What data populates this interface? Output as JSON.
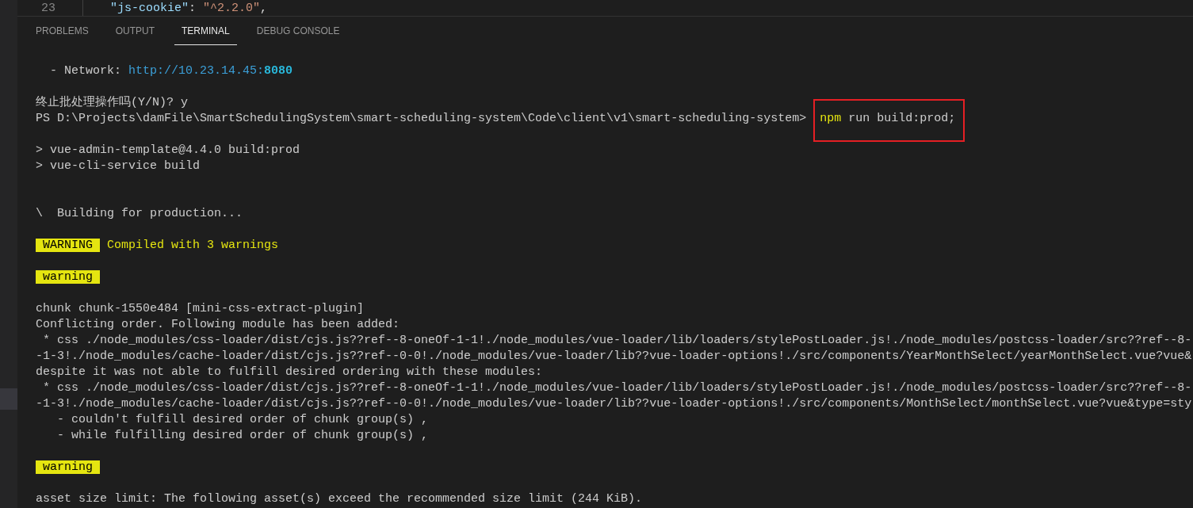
{
  "editor": {
    "line_number": "23",
    "key": "\"js-cookie\"",
    "separator": ": ",
    "value": "\"^2.2.0\"",
    "trailing": ","
  },
  "panel": {
    "tabs": [
      {
        "label": "PROBLEMS",
        "selected": false
      },
      {
        "label": "OUTPUT",
        "selected": false
      },
      {
        "label": "TERMINAL",
        "selected": true
      },
      {
        "label": "DEBUG CONSOLE",
        "selected": false
      }
    ]
  },
  "terminal": {
    "lines": [
      {
        "kind": "network",
        "label": "  - Network: ",
        "url": "http://10.23.14.45:",
        "port": "8080"
      },
      {
        "kind": "blank"
      },
      {
        "kind": "text",
        "text": "终止批处理操作吗(Y/N)? y"
      },
      {
        "kind": "prompt",
        "path": "PS D:\\Projects\\damFile\\SmartSchedulingSystem\\smart-scheduling-system\\Code\\client\\v1\\smart-scheduling-system> ",
        "command": "npm",
        "args": " run build:prod;",
        "highlighted": true
      },
      {
        "kind": "blank"
      },
      {
        "kind": "text",
        "text": "> vue-admin-template@4.4.0 build:prod"
      },
      {
        "kind": "text",
        "text": "> vue-cli-service build"
      },
      {
        "kind": "blank"
      },
      {
        "kind": "blank"
      },
      {
        "kind": "spinner",
        "glyph": "\\",
        "text": "  Building for production..."
      },
      {
        "kind": "blank"
      },
      {
        "kind": "badge",
        "badge": "WARNING",
        "text": "Compiled with 3 warnings"
      },
      {
        "kind": "blank"
      },
      {
        "kind": "badge",
        "badge": "warning"
      },
      {
        "kind": "blank"
      },
      {
        "kind": "text",
        "text": "chunk chunk-1550e484 [mini-css-extract-plugin]"
      },
      {
        "kind": "text",
        "text": "Conflicting order. Following module has been added:"
      },
      {
        "kind": "text",
        "text": " * css ./node_modules/css-loader/dist/cjs.js??ref--8-oneOf-1-1!./node_modules/vue-loader/lib/loaders/stylePostLoader.js!./node_modules/postcss-loader/src??ref--8-"
      },
      {
        "kind": "text",
        "text": "-1-3!./node_modules/cache-loader/dist/cjs.js??ref--0-0!./node_modules/vue-loader/lib??vue-loader-options!./src/components/YearMonthSelect/yearMonthSelect.vue?vue&"
      },
      {
        "kind": "text",
        "text": "despite it was not able to fulfill desired ordering with these modules:"
      },
      {
        "kind": "text",
        "text": " * css ./node_modules/css-loader/dist/cjs.js??ref--8-oneOf-1-1!./node_modules/vue-loader/lib/loaders/stylePostLoader.js!./node_modules/postcss-loader/src??ref--8-"
      },
      {
        "kind": "text",
        "text": "-1-3!./node_modules/cache-loader/dist/cjs.js??ref--0-0!./node_modules/vue-loader/lib??vue-loader-options!./src/components/MonthSelect/monthSelect.vue?vue&type=sty"
      },
      {
        "kind": "text",
        "text": "   - couldn't fulfill desired order of chunk group(s) ,"
      },
      {
        "kind": "text",
        "text": "   - while fulfilling desired order of chunk group(s) ,"
      },
      {
        "kind": "blank"
      },
      {
        "kind": "badge",
        "badge": "warning"
      },
      {
        "kind": "blank"
      },
      {
        "kind": "text",
        "text": "asset size limit: The following asset(s) exceed the recommended size limit (244 KiB)."
      }
    ]
  }
}
